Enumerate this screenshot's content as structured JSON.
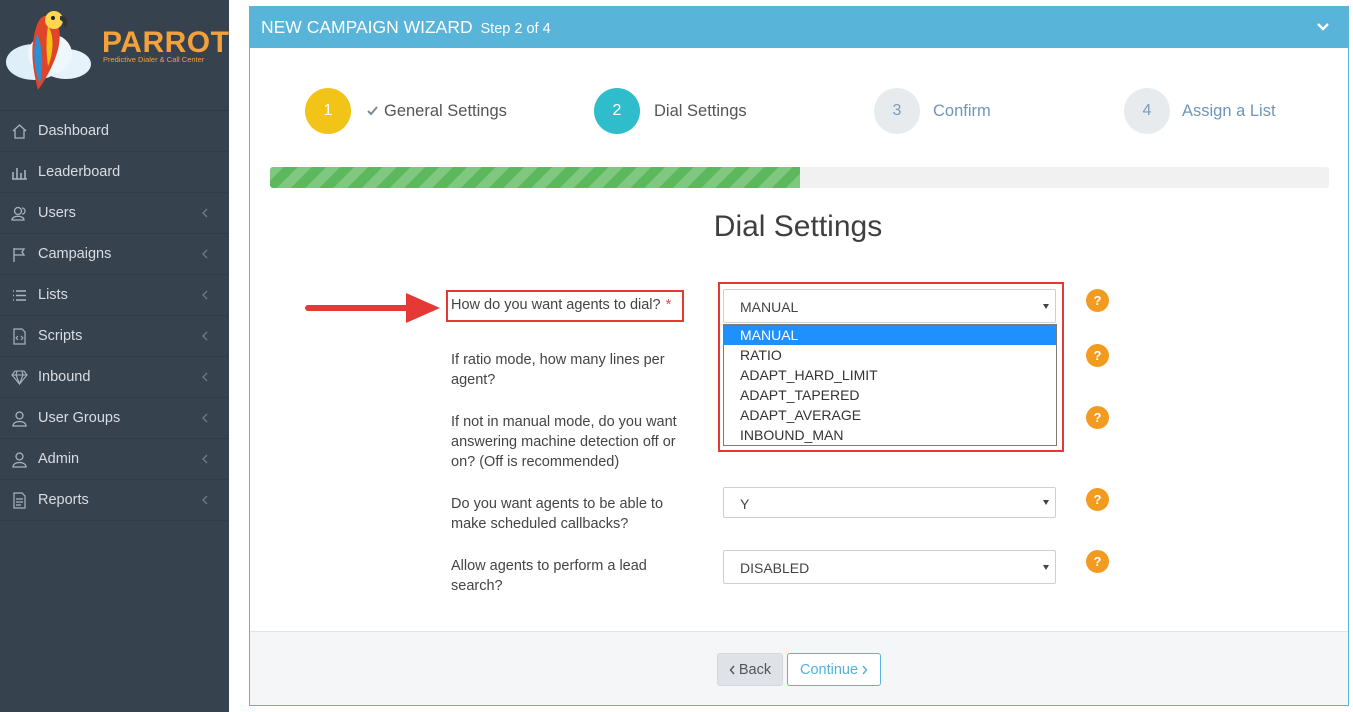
{
  "brand": {
    "name": "PARROT",
    "tagline": "Predictive Dialer & Call Center"
  },
  "sidebar": {
    "items": [
      {
        "label": "Dashboard",
        "icon": "home-icon",
        "submenu": false
      },
      {
        "label": "Leaderboard",
        "icon": "bar-chart-icon",
        "submenu": false
      },
      {
        "label": "Users",
        "icon": "users-icon",
        "submenu": true
      },
      {
        "label": "Campaigns",
        "icon": "flag-icon",
        "submenu": true
      },
      {
        "label": "Lists",
        "icon": "list-icon",
        "submenu": true
      },
      {
        "label": "Scripts",
        "icon": "file-code-icon",
        "submenu": true
      },
      {
        "label": "Inbound",
        "icon": "diamond-icon",
        "submenu": true
      },
      {
        "label": "User Groups",
        "icon": "user-group-icon",
        "submenu": true
      },
      {
        "label": "Admin",
        "icon": "admin-user-icon",
        "submenu": true
      },
      {
        "label": "Reports",
        "icon": "document-icon",
        "submenu": true
      }
    ]
  },
  "panel": {
    "title": "NEW CAMPAIGN WIZARD",
    "step_text": "Step 2 of 4"
  },
  "wizard": {
    "steps": [
      {
        "number": "1",
        "label": "General Settings",
        "state": "done"
      },
      {
        "number": "2",
        "label": "Dial Settings",
        "state": "active"
      },
      {
        "number": "3",
        "label": "Confirm",
        "state": "pending"
      },
      {
        "number": "4",
        "label": "Assign a List",
        "state": "pending"
      }
    ],
    "progress_fraction": 0.5
  },
  "section_title": "Dial Settings",
  "form": {
    "dial_method": {
      "question": "How do you want agents to dial?",
      "required_mark": "*",
      "value": "MANUAL",
      "options": [
        "MANUAL",
        "RATIO",
        "ADAPT_HARD_LIMIT",
        "ADAPT_TAPERED",
        "ADAPT_AVERAGE",
        "INBOUND_MAN"
      ],
      "highlighted": "MANUAL"
    },
    "ratio_lines": {
      "question_line1": "If ratio mode, how many lines per",
      "question_line2": "agent?"
    },
    "amd": {
      "question_line1": "If not in manual mode, do you want",
      "question_line2": "answering machine detection off or",
      "question_line3": "on? (Off is recommended)"
    },
    "callbacks": {
      "question_line1": "Do you want agents to be able to",
      "question_line2": "make scheduled callbacks?",
      "value": "Y"
    },
    "lead_search": {
      "question_line1": "Allow agents to perform a lead",
      "question_line2": "search?",
      "value": "DISABLED"
    },
    "help_label": "?"
  },
  "footer": {
    "back_label": "Back",
    "continue_label": "Continue"
  },
  "colors": {
    "sidebar_bg": "#37424f",
    "header_bg": "#58b4d9",
    "step1": "#f2c418",
    "step2": "#2fbdcb",
    "progress": "#5cb85c",
    "help": "#f29b1e",
    "highlight_box": "#e53935",
    "dropdown_selected": "#1e90ff"
  }
}
